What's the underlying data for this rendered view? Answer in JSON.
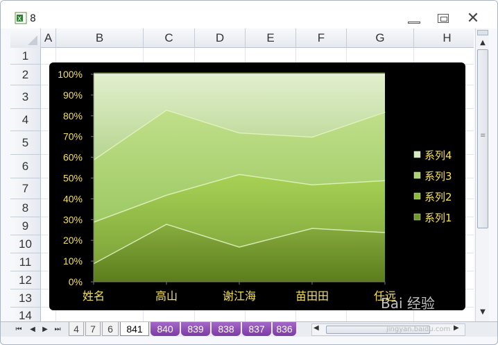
{
  "window": {
    "title": "8",
    "minimize": "—",
    "restore": "□",
    "close": "✕"
  },
  "columns": [
    "A",
    "B",
    "C",
    "D",
    "E",
    "F",
    "G",
    "H"
  ],
  "rows": [
    "1",
    "2",
    "3",
    "4",
    "5",
    "6",
    "7",
    "8",
    "9",
    "10",
    "11",
    "12",
    "13",
    "14"
  ],
  "sheet_tabs": [
    "4",
    "7",
    "6",
    "841",
    "840",
    "839",
    "838",
    "837",
    "836"
  ],
  "active_tab": "841",
  "nav_buttons": [
    "⏮",
    "◀",
    "▶",
    "⏭"
  ],
  "watermark": "Bai 经验",
  "watermark_url": "jingyan.baidu.com",
  "colors": {
    "background": "#000000",
    "tick_text": "#f3e05a",
    "legend_text": "#f3e05a",
    "area_top": "#cfe6a5",
    "area_mid": "#a9d46e",
    "area_low": "#8cbd3a",
    "area_bottom": "#6f9a2a"
  },
  "chart_data": {
    "type": "area",
    "stacking": "percent",
    "categories": [
      "姓名",
      "高山",
      "谢江海",
      "苗田田",
      "任远"
    ],
    "series": [
      {
        "name": "系列1",
        "values": [
          9,
          28,
          17,
          26,
          24
        ]
      },
      {
        "name": "系列2",
        "values": [
          20,
          14,
          35,
          21,
          25
        ]
      },
      {
        "name": "系列3",
        "values": [
          30,
          41,
          20,
          23,
          33
        ]
      },
      {
        "name": "系列4",
        "values": [
          41,
          17,
          28,
          30,
          18
        ]
      }
    ],
    "y_ticks": [
      "0%",
      "10%",
      "20%",
      "30%",
      "40%",
      "50%",
      "60%",
      "70%",
      "80%",
      "90%",
      "100%"
    ],
    "ylim": [
      0,
      100
    ],
    "legend": [
      "系列4",
      "系列3",
      "系列2",
      "系列1"
    ],
    "legend_position": "right",
    "grid": false
  }
}
